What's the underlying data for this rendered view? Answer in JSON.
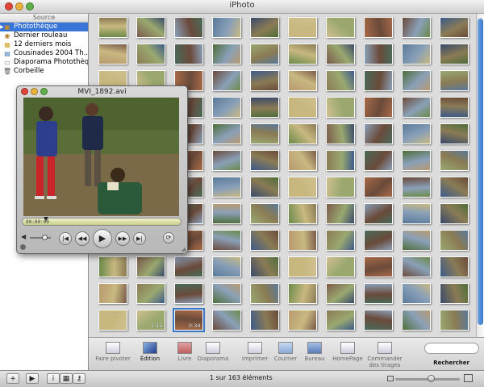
{
  "window": {
    "title": "iPhoto"
  },
  "sidebar": {
    "header": "Source",
    "items": [
      {
        "label": "Photothèque",
        "icon": "library-icon",
        "selected": true
      },
      {
        "label": "Dernier rouleau",
        "icon": "film-roll-icon",
        "selected": false
      },
      {
        "label": "12 derniers mois",
        "icon": "calendar-icon",
        "selected": false
      },
      {
        "label": "Cousinades 2004 Th...",
        "icon": "album-icon",
        "selected": false
      },
      {
        "label": "Diaporama Photothèque",
        "icon": "slideshow-icon",
        "selected": false
      },
      {
        "label": "Corbeille",
        "icon": "trash-icon",
        "selected": false
      }
    ]
  },
  "viewer": {
    "columns": 10,
    "rows": 12,
    "durations": [
      {
        "index": 111,
        "text": "1:15"
      },
      {
        "index": 112,
        "text": "0:34"
      }
    ],
    "selected_index": 112,
    "palettes": [
      "#6b8a4a",
      "#4f6e3a",
      "#8a7b55",
      "#3c5a8a",
      "#a86a48",
      "#c8b880",
      "#5a7a9a",
      "#7a5a4a",
      "#9aa870",
      "#4a6a5a",
      "#b89a70",
      "#6a4a3a",
      "#d0c090",
      "#3a4a6a",
      "#8aa0b8"
    ]
  },
  "quicktime": {
    "title": "MVI_1892.avi",
    "timecode": "00:00:00",
    "progress": 0.15,
    "volume": 0.7
  },
  "toolbar": {
    "items": [
      {
        "label": "Faire pivoter",
        "active": false
      },
      {
        "label": "Édition",
        "active": true
      },
      {
        "label": "Livre",
        "active": false
      },
      {
        "label": "Diaporama",
        "active": false
      },
      {
        "label": "Imprimer",
        "active": false
      },
      {
        "label": "Courrier",
        "active": false
      },
      {
        "label": "Bureau",
        "active": false
      },
      {
        "label": "HomePage",
        "active": false
      },
      {
        "label": "Commander des tirages",
        "active": false
      }
    ],
    "search_label": "Rechercher",
    "search_placeholder": ""
  },
  "status": {
    "count": "1 sur 163 éléments",
    "zoom": 0.55
  }
}
